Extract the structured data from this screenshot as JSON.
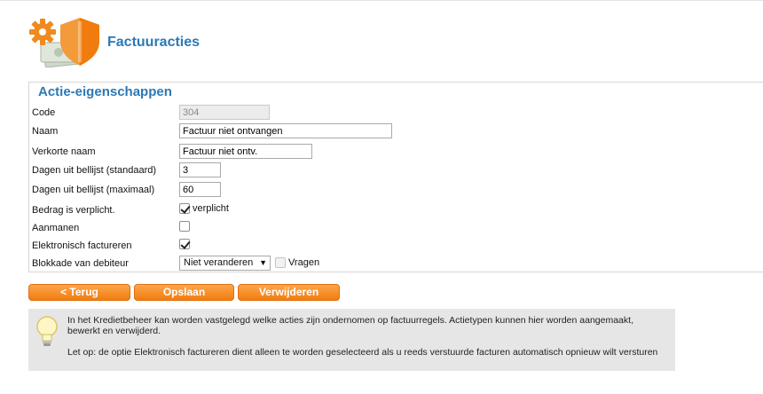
{
  "header": {
    "title": "Factuuracties"
  },
  "panel": {
    "title": "Actie-eigenschappen"
  },
  "form": {
    "code": {
      "label": "Code",
      "value": "304"
    },
    "naam": {
      "label": "Naam",
      "value": "Factuur niet ontvangen"
    },
    "verkorte_naam": {
      "label": "Verkorte naam",
      "value": "Factuur niet ontv."
    },
    "dagen_standaard": {
      "label": "Dagen uit bellijst (standaard)",
      "value": "3"
    },
    "dagen_maximaal": {
      "label": "Dagen uit bellijst (maximaal)",
      "value": "60"
    },
    "bedrag_verplicht": {
      "label": "Bedrag is verplicht.",
      "checkbox_label": "verplicht",
      "checked": true
    },
    "aanmanen": {
      "label": "Aanmanen",
      "checked": false
    },
    "elektronisch": {
      "label": "Elektronisch factureren",
      "checked": true
    },
    "blokkade": {
      "label": "Blokkade van debiteur",
      "selected": "Niet veranderen",
      "vragen_label": "Vragen",
      "vragen_checked": false
    }
  },
  "buttons": {
    "back": "< Terug",
    "save": "Opslaan",
    "delete": "Verwijderen"
  },
  "info": {
    "text1": "In het Kredietbeheer kan worden vastgelegd welke acties zijn ondernomen op factuurregels. Actietypen kunnen hier worden aangemaakt, bewerkt en verwijderd.",
    "text2": "Let op: de optie Elektronisch factureren dient alleen te worden geselecteerd als u reeds verstuurde facturen automatisch opnieuw wilt versturen"
  },
  "colors": {
    "accent": "#2b79b6",
    "button": "#f08a1e"
  }
}
